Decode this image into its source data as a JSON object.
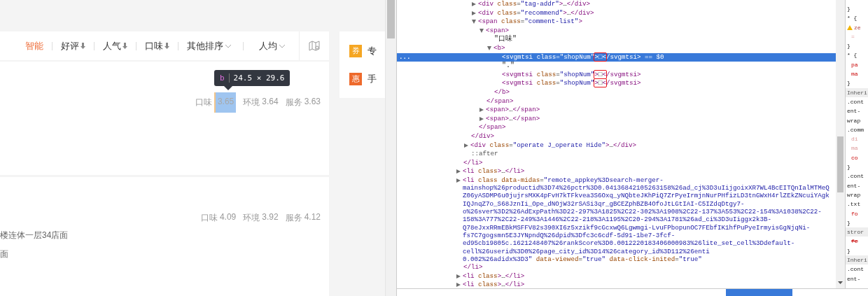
{
  "page": {
    "sort_tabs": [
      {
        "label": "智能",
        "kind": "plain",
        "selected": true
      },
      {
        "label": "好评",
        "kind": "sort",
        "selected": false
      },
      {
        "label": "人气",
        "kind": "sort",
        "selected": false
      },
      {
        "label": "口味",
        "kind": "sort",
        "selected": false
      },
      {
        "label": "其他排序",
        "kind": "dropdown",
        "selected": false
      },
      {
        "label": "人均",
        "kind": "dropdown",
        "selected": false
      }
    ],
    "listings": [
      {
        "scores": [
          {
            "label": "口味",
            "value": "3.65",
            "inspected": true
          },
          {
            "label": "环境",
            "value": "3.64",
            "inspected": false
          },
          {
            "label": "服务",
            "value": "3.63",
            "inspected": false
          }
        ]
      },
      {
        "scores": [
          {
            "label": "口味",
            "value": "4.09",
            "inspected": false
          },
          {
            "label": "环境",
            "value": "3.92",
            "inspected": false
          },
          {
            "label": "服务",
            "value": "4.12",
            "inspected": false
          }
        ],
        "address_lines": [
          "楼连体一层34店面",
          "面"
        ]
      }
    ],
    "inspect_tooltip": {
      "tag": "b",
      "size": "24.5 × 29.6"
    },
    "promos": [
      {
        "badge": "券",
        "text": "专",
        "color": "#f5a623"
      },
      {
        "badge": "惠",
        "text": "手",
        "color": "#ee6a2c"
      }
    ]
  },
  "elements_tree": [
    {
      "kind": "tail",
      "children": [
        {
          "kind": "tail",
          "children": [
            {
              "kind": "element",
              "open": "<div class=\"tag-addr\">…</div>",
              "expanded": false,
              "selected": false
            },
            {
              "kind": "element",
              "open": "<div class=\"recommend\">…</div>",
              "expanded": false,
              "selected": false
            },
            {
              "kind": "element",
              "open": "<span class=\"comment-list\">",
              "expanded": true,
              "selected": false,
              "children": [
                {
                  "kind": "element",
                  "open": "<span>",
                  "expanded": true,
                  "selected": false,
                  "children": [
                    {
                      "kind": "text",
                      "text": "\"口味\"",
                      "selected": false
                    },
                    {
                      "kind": "element",
                      "open": "<b>",
                      "expanded": true,
                      "selected": false,
                      "children": [
                        {
                          "kind": "inline",
                          "open": "<svgmtsi class=\"shopNum\">□</svgmtsi>",
                          "selected": true,
                          "boxed": true,
                          "more_marker": "...",
                          "console_ref": "== $0"
                        },
                        {
                          "kind": "text",
                          "text": "\".\"",
                          "selected": false
                        },
                        {
                          "kind": "inline",
                          "open": "<svgmtsi class=\"shopNum\">□</svgmtsi>",
                          "selected": false,
                          "boxed": true
                        },
                        {
                          "kind": "inline",
                          "open": "<svgmtsi class=\"shopNum\">□</svgmtsi>",
                          "selected": false,
                          "boxed": true
                        }
                      ],
                      "close": "</b>"
                    }
                  ],
                  "close": "</span>"
                },
                {
                  "kind": "element",
                  "open": "<span>…</span>",
                  "expanded": false,
                  "selected": false
                },
                {
                  "kind": "element",
                  "open": "<span>…</span>",
                  "expanded": false,
                  "selected": false
                }
              ],
              "close": "</span>"
            }
          ],
          "close": "</div>"
        },
        {
          "kind": "element",
          "open": "<div class=\"operate J_operate Hide\">…</div>",
          "expanded": false,
          "selected": false
        },
        {
          "kind": "pseudo",
          "text": "::after",
          "selected": false
        }
      ],
      "close": "</li>"
    },
    {
      "kind": "element",
      "open": "<li class>…</li>",
      "expanded": false,
      "selected": false
    },
    {
      "kind": "element",
      "lines": [
        "<li class data-midas=\"remote_appkey%3Dsearch-merger-",
        "mainshop%26productid%3D74%26pctr%3D0.04136842105263158%26ad_cj%3D3uIijgoixXR7WL4BcEITQnIalMTMeQ",
        "Z06yASDMP6u0jujrsMXK4pFvH7kTFkvea3S6Oxq_yNQbteJKhPiQ7ZrPyeIrmjnNurPHfizLD3tnGWxH4rlZEkZNcuiYAgk",
        "IQJnqZ7o_S68JznIi_Ope_dNOjW32rSASi3qr_gBCEZphBZB4OfoJtLGtIAI-C5IZdqDtgy7-",
        "o%26sver%3D2%26AdExpPath%3D22-297%3A1825%2C22-302%3A1908%2C22-137%3A553%2C22-154%3A1038%2C22-",
        "158%3A777%2C22-249%3A1446%2C22-218%3A1195%2C20-294%3A1781%26ad_ci%3D3uIiggx2k3B-",
        "Q78eJxxRRmEBkMSFFV82s390XI6z5xzikf9cGcxwQ6Lgwmgi-LvuFPbopunOC7FEbfIK1hfPuPyeIrmyisGgNjqNi-",
        "fs7C7gogsmn5E3JYNpndQ%26dpid%3Dfc3c6cdf-5d91-1be7-3fcf-",
        "ed95cb19805c.1621248407%26rankScore%3D0.0012220183406000983%26lite_set_cell%3Ddefault-",
        "cell%26userid%3D0%26page_city_id%3D14%26category_id%3D112%26enti",
        "0.002%26adidx%3D3\" data-viewed=\"true\" data-click-inited=\"true\""
      ],
      "expanded": false,
      "selected": false,
      "close": "</li>"
    },
    {
      "kind": "element",
      "open": "<li class>…</li>",
      "expanded": false,
      "selected": false
    },
    {
      "kind": "element",
      "open": "<li class>…</li>",
      "expanded": false,
      "selected": false
    }
  ],
  "styles_pane": [
    {
      "text": "}",
      "kind": "rule"
    },
    {
      "text": "* {",
      "kind": "rule"
    },
    {
      "text": "ze",
      "kind": "warning"
    },
    {
      "text": "=",
      "kind": "dim"
    },
    {
      "text": "}",
      "kind": "rule"
    },
    {
      "text": "* {",
      "kind": "rule"
    },
    {
      "text": "pa",
      "kind": "prop"
    },
    {
      "text": "ma",
      "kind": "prop"
    },
    {
      "text": "}",
      "kind": "rule"
    },
    {
      "text": "Inheri",
      "kind": "section"
    },
    {
      "text": ".cont",
      "kind": "rule"
    },
    {
      "text": "ent-",
      "kind": "rule"
    },
    {
      "text": "wrap",
      "kind": "rule"
    },
    {
      "text": ".comm",
      "kind": "rule"
    },
    {
      "text": "di",
      "kind": "dim"
    },
    {
      "text": "ma",
      "kind": "dim"
    },
    {
      "text": "co",
      "kind": "prop"
    },
    {
      "text": "}",
      "kind": "rule"
    },
    {
      "text": ".cont",
      "kind": "rule"
    },
    {
      "text": "ent-",
      "kind": "rule"
    },
    {
      "text": "wrap",
      "kind": "rule"
    },
    {
      "text": ".txt",
      "kind": "rule"
    },
    {
      "text": "fo",
      "kind": "prop"
    },
    {
      "text": "}",
      "kind": "rule"
    },
    {
      "text": "stror",
      "kind": "section"
    },
    {
      "text": "fe",
      "kind": "struck"
    },
    {
      "text": "}",
      "kind": "rule"
    },
    {
      "text": "Inheri",
      "kind": "section"
    },
    {
      "text": ".cont",
      "kind": "rule"
    },
    {
      "text": "ent-",
      "kind": "rule"
    }
  ]
}
